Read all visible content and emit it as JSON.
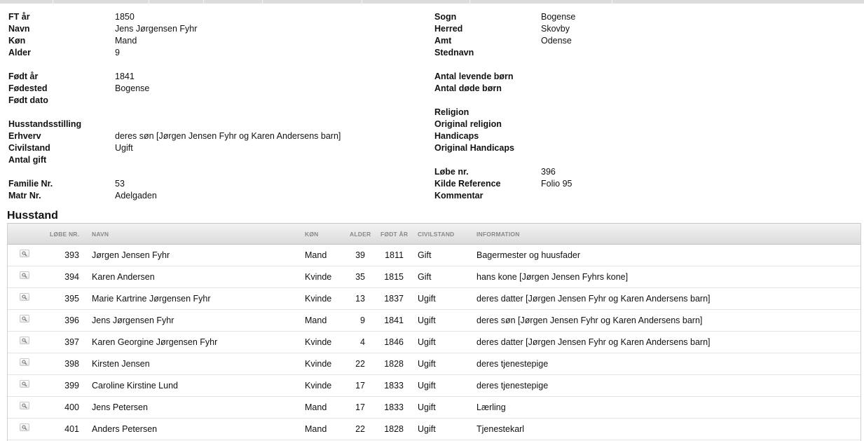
{
  "details": {
    "left": [
      {
        "label": "FT år",
        "value": "1850"
      },
      {
        "label": "Navn",
        "value": "Jens Jørgensen Fyhr"
      },
      {
        "label": "Køn",
        "value": "Mand"
      },
      {
        "label": "Alder",
        "value": "9"
      },
      {
        "label": "Født år",
        "value": "1841"
      },
      {
        "label": "Fødested",
        "value": "Bogense"
      },
      {
        "label": "Født dato",
        "value": ""
      },
      {
        "label": "Husstandsstilling",
        "value": ""
      },
      {
        "label": "Erhverv",
        "value": "deres søn [Jørgen Jensen Fyhr og Karen Andersens barn]"
      },
      {
        "label": "Civilstand",
        "value": "Ugift"
      },
      {
        "label": "Antal gift",
        "value": ""
      },
      {
        "label": "Familie Nr.",
        "value": "53"
      },
      {
        "label": "Matr Nr.",
        "value": "Adelgaden"
      }
    ],
    "right": [
      {
        "label": "Sogn",
        "value": "Bogense"
      },
      {
        "label": "Herred",
        "value": "Skovby"
      },
      {
        "label": "Amt",
        "value": "Odense"
      },
      {
        "label": "Stednavn",
        "value": ""
      },
      {
        "label": "Antal levende børn",
        "value": ""
      },
      {
        "label": "Antal døde børn",
        "value": ""
      },
      {
        "label": "Religion",
        "value": ""
      },
      {
        "label": "Original religion",
        "value": ""
      },
      {
        "label": "Handicaps",
        "value": ""
      },
      {
        "label": "Original Handicaps",
        "value": ""
      },
      {
        "label": "Løbe nr.",
        "value": "396"
      },
      {
        "label": "Kilde Reference",
        "value": "Folio 95"
      },
      {
        "label": "Kommentar",
        "value": ""
      }
    ]
  },
  "household": {
    "title": "Husstand",
    "columns": [
      "LØBE NR.",
      "NAVN",
      "KØN",
      "ALDER",
      "FØDT ÅR",
      "CIVILSTAND",
      "INFORMATION"
    ],
    "rows": [
      {
        "lobe": "393",
        "navn": "Jørgen Jensen Fyhr",
        "kon": "Mand",
        "alder": "39",
        "fodt": "1811",
        "civil": "Gift",
        "info": "Bagermester og huusfader"
      },
      {
        "lobe": "394",
        "navn": "Karen Andersen",
        "kon": "Kvinde",
        "alder": "35",
        "fodt": "1815",
        "civil": "Gift",
        "info": "hans kone [Jørgen Jensen Fyhrs kone]"
      },
      {
        "lobe": "395",
        "navn": "Marie Kartrine Jørgensen Fyhr",
        "kon": "Kvinde",
        "alder": "13",
        "fodt": "1837",
        "civil": "Ugift",
        "info": "deres datter [Jørgen Jensen Fyhr og Karen Andersens barn]"
      },
      {
        "lobe": "396",
        "navn": "Jens Jørgensen Fyhr",
        "kon": "Mand",
        "alder": "9",
        "fodt": "1841",
        "civil": "Ugift",
        "info": "deres søn [Jørgen Jensen Fyhr og Karen Andersens barn]"
      },
      {
        "lobe": "397",
        "navn": "Karen Georgine Jørgensen Fyhr",
        "kon": "Kvinde",
        "alder": "4",
        "fodt": "1846",
        "civil": "Ugift",
        "info": "deres datter [Jørgen Jensen Fyhr og Karen Andersens barn]"
      },
      {
        "lobe": "398",
        "navn": "Kirsten Jensen",
        "kon": "Kvinde",
        "alder": "22",
        "fodt": "1828",
        "civil": "Ugift",
        "info": "deres tjenestepige"
      },
      {
        "lobe": "399",
        "navn": "Caroline Kirstine Lund",
        "kon": "Kvinde",
        "alder": "17",
        "fodt": "1833",
        "civil": "Ugift",
        "info": "deres tjenestepige"
      },
      {
        "lobe": "400",
        "navn": "Jens Petersen",
        "kon": "Mand",
        "alder": "17",
        "fodt": "1833",
        "civil": "Ugift",
        "info": "Lærling"
      },
      {
        "lobe": "401",
        "navn": "Anders Petersen",
        "kon": "Mand",
        "alder": "22",
        "fodt": "1828",
        "civil": "Ugift",
        "info": "Tjenestekarl"
      }
    ]
  }
}
